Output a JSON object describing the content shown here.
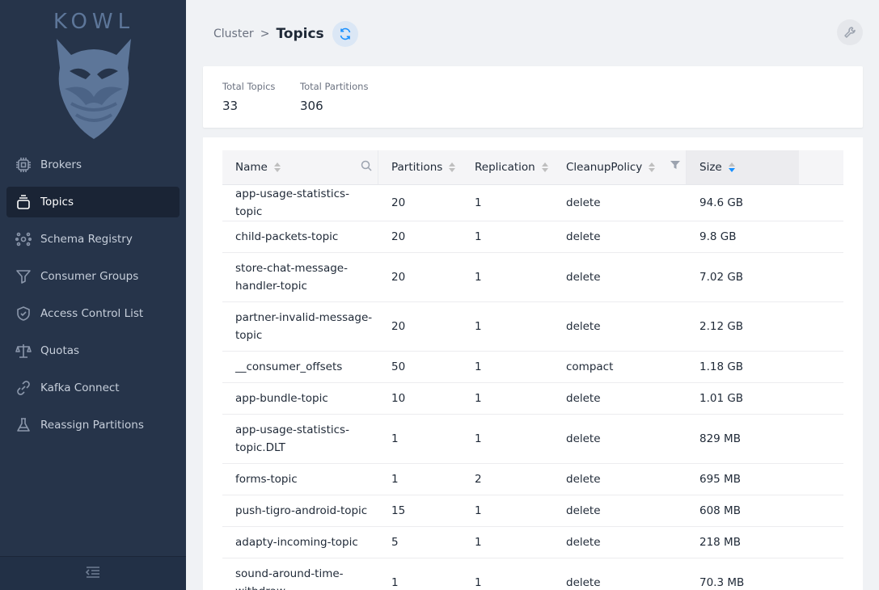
{
  "app": {
    "logo_text": "KOWL"
  },
  "sidebar": {
    "items": [
      {
        "label": "Brokers",
        "icon": "cpu-icon",
        "active": false
      },
      {
        "label": "Topics",
        "icon": "collection-icon",
        "active": true
      },
      {
        "label": "Schema Registry",
        "icon": "network-icon",
        "active": false
      },
      {
        "label": "Consumer Groups",
        "icon": "funnel-icon",
        "active": false
      },
      {
        "label": "Access Control List",
        "icon": "shield-check-icon",
        "active": false
      },
      {
        "label": "Quotas",
        "icon": "scale-icon",
        "active": false
      },
      {
        "label": "Kafka Connect",
        "icon": "link-icon",
        "active": false
      },
      {
        "label": "Reassign Partitions",
        "icon": "beaker-icon",
        "active": false
      }
    ],
    "collapse_icon": "menu-collapse-icon"
  },
  "header": {
    "breadcrumb_parent": "Cluster",
    "breadcrumb_separator": ">",
    "title": "Topics"
  },
  "stats": {
    "total_topics_label": "Total Topics",
    "total_topics_value": "33",
    "total_partitions_label": "Total Partitions",
    "total_partitions_value": "306"
  },
  "table": {
    "columns": {
      "name": "Name",
      "partitions": "Partitions",
      "replication": "Replication",
      "cleanup": "CleanupPolicy",
      "size": "Size"
    },
    "rows": [
      {
        "name": "app-usage-statistics-topic",
        "partitions": "20",
        "replication": "1",
        "cleanup": "delete",
        "size": "94.6 GB"
      },
      {
        "name": "child-packets-topic",
        "partitions": "20",
        "replication": "1",
        "cleanup": "delete",
        "size": "9.8 GB"
      },
      {
        "name": "store-chat-message-handler-topic",
        "partitions": "20",
        "replication": "1",
        "cleanup": "delete",
        "size": "7.02 GB"
      },
      {
        "name": "partner-invalid-message-topic",
        "partitions": "20",
        "replication": "1",
        "cleanup": "delete",
        "size": "2.12 GB"
      },
      {
        "name": "__consumer_offsets",
        "partitions": "50",
        "replication": "1",
        "cleanup": "compact",
        "size": "1.18 GB"
      },
      {
        "name": "app-bundle-topic",
        "partitions": "10",
        "replication": "1",
        "cleanup": "delete",
        "size": "1.01 GB"
      },
      {
        "name": "app-usage-statistics-topic.DLT",
        "partitions": "1",
        "replication": "1",
        "cleanup": "delete",
        "size": "829 MB"
      },
      {
        "name": "forms-topic",
        "partitions": "1",
        "replication": "2",
        "cleanup": "delete",
        "size": "695 MB"
      },
      {
        "name": "push-tigro-android-topic",
        "partitions": "15",
        "replication": "1",
        "cleanup": "delete",
        "size": "608 MB"
      },
      {
        "name": "adapty-incoming-topic",
        "partitions": "5",
        "replication": "1",
        "cleanup": "delete",
        "size": "218 MB"
      },
      {
        "name": "sound-around-time-withdraw",
        "partitions": "1",
        "replication": "1",
        "cleanup": "delete",
        "size": "70.3 MB"
      }
    ]
  },
  "colors": {
    "sidebar_bg": "#26344a",
    "sidebar_active": "#1a2435",
    "accent": "#1890ff",
    "page_bg": "#f0f2f5"
  }
}
